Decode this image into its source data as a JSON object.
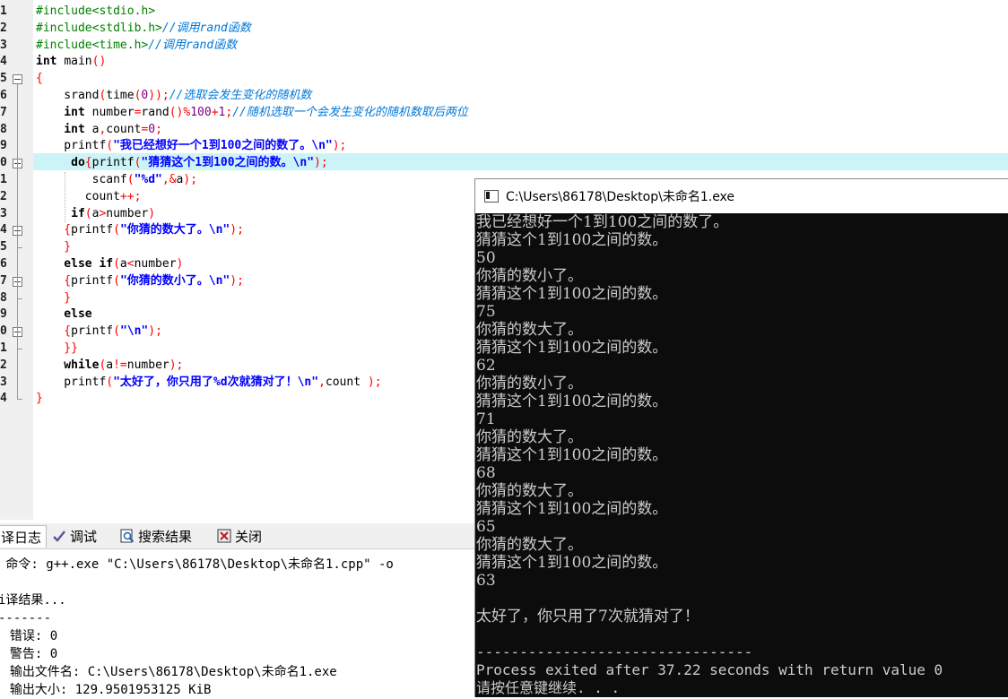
{
  "editor": {
    "line_numbers": [
      "1",
      "2",
      "3",
      "4",
      "5",
      "6",
      "7",
      "8",
      "9",
      "0",
      "1",
      "2",
      "3",
      "4",
      "5",
      "6",
      "7",
      "8",
      "9",
      "0",
      "1",
      "2",
      "3",
      "4"
    ],
    "code_lines": [
      [
        {
          "t": "#include<stdio.h>",
          "c": "pp"
        }
      ],
      [
        {
          "t": "#include<stdlib.h>",
          "c": "pp"
        },
        {
          "t": "//调用rand函数",
          "c": "cm"
        }
      ],
      [
        {
          "t": "#include<time.h>",
          "c": "pp"
        },
        {
          "t": "//调用rand函数",
          "c": "cm"
        }
      ],
      [
        {
          "t": "int ",
          "c": "kw"
        },
        {
          "t": "main",
          "c": "id"
        },
        {
          "t": "()",
          "c": "sym"
        }
      ],
      [
        {
          "t": "{",
          "c": "sym"
        }
      ],
      [
        {
          "t": "    srand",
          "c": "id"
        },
        {
          "t": "(",
          "c": "sym"
        },
        {
          "t": "time",
          "c": "id"
        },
        {
          "t": "(",
          "c": "sym"
        },
        {
          "t": "0",
          "c": "num"
        },
        {
          "t": "));",
          "c": "sym"
        },
        {
          "t": "//选取会发生变化的随机数",
          "c": "cm"
        }
      ],
      [
        {
          "t": "    int ",
          "c": "kw"
        },
        {
          "t": "number",
          "c": "id"
        },
        {
          "t": "=",
          "c": "sym"
        },
        {
          "t": "rand",
          "c": "id"
        },
        {
          "t": "()%",
          "c": "sym"
        },
        {
          "t": "100",
          "c": "num"
        },
        {
          "t": "+",
          "c": "sym"
        },
        {
          "t": "1",
          "c": "num"
        },
        {
          "t": ";",
          "c": "sym"
        },
        {
          "t": "//随机选取一个会发生变化的随机数取后两位",
          "c": "cm"
        }
      ],
      [
        {
          "t": "    int ",
          "c": "kw"
        },
        {
          "t": "a",
          "c": "id"
        },
        {
          "t": ",",
          "c": "sym"
        },
        {
          "t": "count",
          "c": "id"
        },
        {
          "t": "=",
          "c": "sym"
        },
        {
          "t": "0",
          "c": "num"
        },
        {
          "t": ";",
          "c": "sym"
        }
      ],
      [
        {
          "t": "    printf",
          "c": "id"
        },
        {
          "t": "(",
          "c": "sym"
        },
        {
          "t": "\"我已经想好一个1到100之间的数了。\\n\"",
          "c": "str"
        },
        {
          "t": ");",
          "c": "sym"
        }
      ],
      [
        {
          "t": "     do",
          "c": "kw"
        },
        {
          "t": "{",
          "c": "sym"
        },
        {
          "t": "printf",
          "c": "id"
        },
        {
          "t": "(",
          "c": "sym"
        },
        {
          "t": "\"猜猜这个1到100之间的数。\\n\"",
          "c": "str"
        },
        {
          "t": ");",
          "c": "sym"
        }
      ],
      [
        {
          "t": "        scanf",
          "c": "id"
        },
        {
          "t": "(",
          "c": "sym"
        },
        {
          "t": "\"%d\"",
          "c": "str"
        },
        {
          "t": ",&",
          "c": "sym"
        },
        {
          "t": "a",
          "c": "id"
        },
        {
          "t": ");",
          "c": "sym"
        }
      ],
      [
        {
          "t": "       count",
          "c": "id"
        },
        {
          "t": "++;",
          "c": "sym"
        }
      ],
      [
        {
          "t": "     if",
          "c": "kw"
        },
        {
          "t": "(",
          "c": "sym"
        },
        {
          "t": "a",
          "c": "id"
        },
        {
          "t": ">",
          "c": "sym"
        },
        {
          "t": "number",
          "c": "id"
        },
        {
          "t": ")",
          "c": "sym"
        }
      ],
      [
        {
          "t": "    {",
          "c": "sym"
        },
        {
          "t": "printf",
          "c": "id"
        },
        {
          "t": "(",
          "c": "sym"
        },
        {
          "t": "\"你猜的数大了。\\n\"",
          "c": "str"
        },
        {
          "t": ");",
          "c": "sym"
        }
      ],
      [
        {
          "t": "    }",
          "c": "sym"
        }
      ],
      [
        {
          "t": "    else if",
          "c": "kw"
        },
        {
          "t": "(",
          "c": "sym"
        },
        {
          "t": "a",
          "c": "id"
        },
        {
          "t": "<",
          "c": "sym"
        },
        {
          "t": "number",
          "c": "id"
        },
        {
          "t": ")",
          "c": "sym"
        }
      ],
      [
        {
          "t": "    {",
          "c": "sym"
        },
        {
          "t": "printf",
          "c": "id"
        },
        {
          "t": "(",
          "c": "sym"
        },
        {
          "t": "\"你猜的数小了。\\n\"",
          "c": "str"
        },
        {
          "t": ");",
          "c": "sym"
        }
      ],
      [
        {
          "t": "    }",
          "c": "sym"
        }
      ],
      [
        {
          "t": "    else",
          "c": "kw"
        }
      ],
      [
        {
          "t": "    {",
          "c": "sym"
        },
        {
          "t": "printf",
          "c": "id"
        },
        {
          "t": "(",
          "c": "sym"
        },
        {
          "t": "\"\\n\"",
          "c": "str"
        },
        {
          "t": ");",
          "c": "sym"
        }
      ],
      [
        {
          "t": "    }}",
          "c": "sym"
        }
      ],
      [
        {
          "t": "    while",
          "c": "kw"
        },
        {
          "t": "(",
          "c": "sym"
        },
        {
          "t": "a",
          "c": "id"
        },
        {
          "t": "!=",
          "c": "sym"
        },
        {
          "t": "number",
          "c": "id"
        },
        {
          "t": ");",
          "c": "sym"
        }
      ],
      [
        {
          "t": "    printf",
          "c": "id"
        },
        {
          "t": "(",
          "c": "sym"
        },
        {
          "t": "\"太好了，你只用了%d次就猜对了！\\n\"",
          "c": "str"
        },
        {
          "t": ",",
          "c": "sym"
        },
        {
          "t": "count ",
          "c": "id"
        },
        {
          "t": ");",
          "c": "sym"
        }
      ],
      [
        {
          "t": "}",
          "c": "sym"
        }
      ]
    ]
  },
  "panel": {
    "tabs": [
      {
        "label": "译日志",
        "icon": "compile-log-icon"
      },
      {
        "label": "调试",
        "icon": "debug-check-icon"
      },
      {
        "label": "搜索结果",
        "icon": "search-results-icon"
      },
      {
        "label": "关闭",
        "icon": "close-panel-icon"
      }
    ],
    "log_lines": [
      " 命令: g++.exe \"C:\\Users\\86178\\Desktop\\未命名1.cpp\" -o",
      "",
      "i译结果...",
      "-------",
      "- 错误: 0",
      "- 警告: 0",
      "- 输出文件名: C:\\Users\\86178\\Desktop\\未命名1.exe",
      "- 输出大小: 129.9501953125 KiB"
    ]
  },
  "console": {
    "title": "C:\\Users\\86178\\Desktop\\未命名1.exe",
    "lines": [
      "我已经想好一个1到100之间的数了。",
      "猜猜这个1到100之间的数。",
      "50",
      "你猜的数小了。",
      "猜猜这个1到100之间的数。",
      "75",
      "你猜的数大了。",
      "猜猜这个1到100之间的数。",
      "62",
      "你猜的数小了。",
      "猜猜这个1到100之间的数。",
      "71",
      "你猜的数大了。",
      "猜猜这个1到100之间的数。",
      "68",
      "你猜的数大了。",
      "猜猜这个1到100之间的数。",
      "65",
      "你猜的数大了。",
      "猜猜这个1到100之间的数。",
      "63",
      "",
      "太好了，你只用了7次就猜对了！",
      "",
      "--------------------------------",
      "Process exited after 37.22 seconds with return value 0",
      "请按任意键继续. . ."
    ]
  }
}
